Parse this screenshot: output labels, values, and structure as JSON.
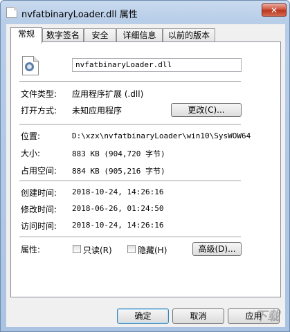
{
  "window": {
    "title": "nvfatbinaryLoader.dll 属性",
    "close_glyph": "✕"
  },
  "tabs": [
    {
      "label": "常规",
      "active": true
    },
    {
      "label": "数字签名",
      "active": false
    },
    {
      "label": "安全",
      "active": false
    },
    {
      "label": "详细信息",
      "active": false
    },
    {
      "label": "以前的版本",
      "active": false
    }
  ],
  "general": {
    "file_name": "nvfatbinaryLoader.dll",
    "file_type_label": "文件类型:",
    "file_type_value": "应用程序扩展 (.dll)",
    "open_with_label": "打开方式:",
    "open_with_value": "未知应用程序",
    "change_button": "更改(C)...",
    "location_label": "位置:",
    "location_value": "D:\\xzx\\nvfatbinaryLoader\\win10\\SysWOW64",
    "size_label": "大小:",
    "size_value": "883 KB (904,720 字节)",
    "disk_size_label": "占用空间:",
    "disk_size_value": "884 KB (905,216 字节)",
    "created_label": "创建时间:",
    "created_value": "2018-10-24, 14:26:16",
    "modified_label": "修改时间:",
    "modified_value": "2018-06-26, 01:24:50",
    "accessed_label": "访问时间:",
    "accessed_value": "2018-10-24, 14:26:16",
    "attributes_label": "属性:",
    "readonly_label": "只读(R)",
    "hidden_label": "隐藏(H)",
    "advanced_button": "高级(D)..."
  },
  "footer": {
    "ok_button": "确定",
    "cancel_button": "取消",
    "apply_button": "应用"
  },
  "watermark": "下载"
}
